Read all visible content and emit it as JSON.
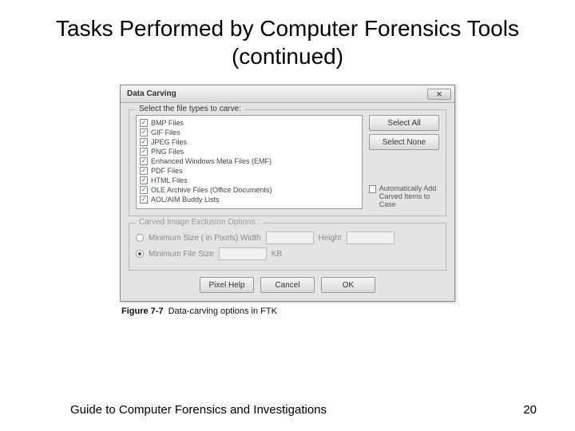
{
  "title": "Tasks Performed by Computer Forensics Tools (continued)",
  "dialog": {
    "title": "Data Carving",
    "close": "✕",
    "group1_label": "Select the file types to carve:",
    "filetypes": [
      "BMP Files",
      "GIF Files",
      "JPEG Files",
      "PNG Files",
      "Enhanced Windows Meta Files (EMF)",
      "PDF Files",
      "HTML Files",
      "OLE Archive Files (Office Documents)",
      "AOL/AIM Buddy Lists"
    ],
    "select_all": "Select All",
    "select_none": "Select None",
    "auto_add": "Automatically Add Carved Items to Case",
    "group2_label": "Carved Image Exclusion Options :",
    "min_pixels": "Minimum Size ( in Pixels)   Width",
    "height_label": "Height",
    "min_filesize": "Minimum File Size",
    "kb": "KB",
    "pixel_help": "Pixel Help",
    "cancel": "Cancel",
    "ok": "OK"
  },
  "caption_ref": "Figure 7-7",
  "caption_text": "Data-carving options in FTK",
  "footer_left": "Guide to Computer Forensics and Investigations",
  "footer_right": "20"
}
